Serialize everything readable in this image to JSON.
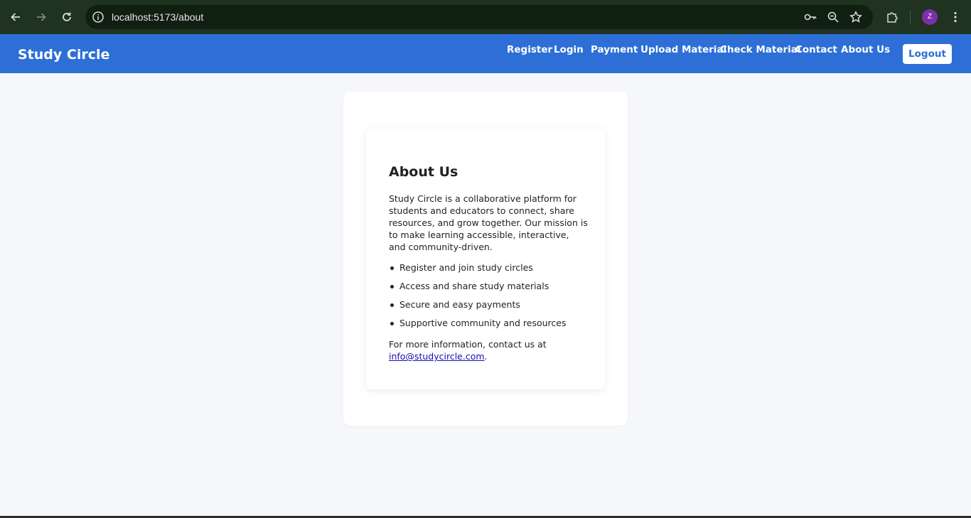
{
  "browser": {
    "url": "localhost:5173/about",
    "profile_initial": "Z",
    "icons": [
      "back-icon",
      "forward-icon",
      "reload-icon",
      "site-info-icon",
      "password-key-icon",
      "zoom-icon",
      "bookmark-star-icon",
      "extensions-icon",
      "menu-kebab-icon"
    ]
  },
  "header": {
    "brand": "Study Circle",
    "nav": [
      "Register",
      "Login",
      "Payment",
      "Upload Material",
      "Check Material",
      "Contact",
      "About Us"
    ],
    "logout_label": "Logout",
    "colors": {
      "bar": "#2d6fd6",
      "text": "#ffffff"
    }
  },
  "about": {
    "title": "About Us",
    "description": "Study Circle is a collaborative platform for students and educators to connect, share resources, and grow together. Our mission is to make learning accessible, interactive, and community-driven.",
    "features": [
      "Register and join study circles",
      "Access and share study materials",
      "Secure and easy payments",
      "Supportive community and resources"
    ],
    "contact_prefix": "For more information, contact us at ",
    "contact_email": "info@studycircle.com",
    "contact_suffix": "."
  }
}
